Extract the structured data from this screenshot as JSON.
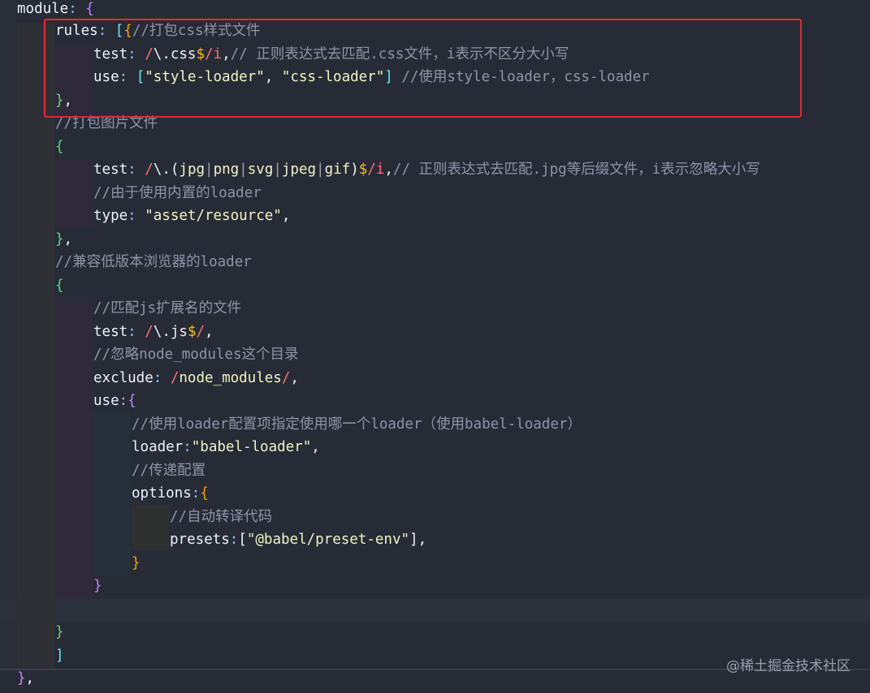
{
  "editor": {
    "lines": [
      "module: {",
      "rules: [{//打包css样式文件",
      "test: /\\.css$/i,// 正则表达式去匹配.css文件，i表示不区分大小写",
      "use: [\"style-loader\", \"css-loader\"] //使用style-loader，css-loader",
      "},",
      "//打包图片文件",
      "{",
      "test: /\\.(jpg|png|svg|jpeg|gif)$/i,// 正则表达式去匹配.jpg等后缀文件，i表示忽略大小写",
      "//由于使用内置的loader",
      "type: \"asset/resource\",",
      "},",
      "//兼容低版本浏览器的loader",
      "{",
      "//匹配js扩展名的文件",
      "test: /\\.js$/,",
      "//忽略node_modules这个目录",
      "exclude: /node_modules/,",
      "use:{",
      "//使用loader配置项指定使用哪一个loader（使用babel-loader）",
      "loader:\"babel-loader\",",
      "//传递配置",
      "options:{",
      "//自动转译代码",
      "presets:[\"@babel/preset-env\"],",
      "}",
      "}",
      "",
      "}",
      "]",
      "},"
    ]
  },
  "tokens": {
    "module": "module",
    "rules": "rules",
    "test": "test",
    "use": "use",
    "type": "type",
    "exclude": "exclude",
    "loader": "loader",
    "options": "options",
    "presets": "presets",
    "c_css": "//打包css样式文件",
    "c_test_css": "// 正则表达式去匹配.css文件，i表示不区分大小写",
    "c_use": "//使用style-loader，css-loader",
    "c_img": "//打包图片文件",
    "c_test_img": "// 正则表达式去匹配.jpg等后缀文件，i表示忽略大小写",
    "c_builtin": "//由于使用内置的loader",
    "c_compat": "//兼容低版本浏览器的loader",
    "c_js": "//匹配js扩展名的文件",
    "c_ignore": "//忽略node_modules这个目录",
    "c_loader": "//使用loader配置项指定使用哪一个loader（使用babel-loader）",
    "c_pass": "//传递配置",
    "c_auto": "//自动转译代码",
    "s_style": "\"style-loader\"",
    "s_css": "\"css-loader\"",
    "s_asset": "\"asset/resource\"",
    "s_babel": "\"babel-loader\"",
    "s_preset": "\"@babel/preset-env\"",
    "r_css": "\\.css",
    "r_jpg": "jpg",
    "r_png": "png",
    "r_svg": "svg",
    "r_jpeg": "jpeg",
    "r_gif": "gif",
    "r_js": "\\.js",
    "r_nm": "node_modules"
  },
  "watermark": "@稀土掘金技术社区",
  "colors": {
    "background": "#272b36",
    "highlight_box": "#e02a36",
    "comment": "#8e95a8",
    "string": "#f1f4c4",
    "regex": "#f87171"
  }
}
